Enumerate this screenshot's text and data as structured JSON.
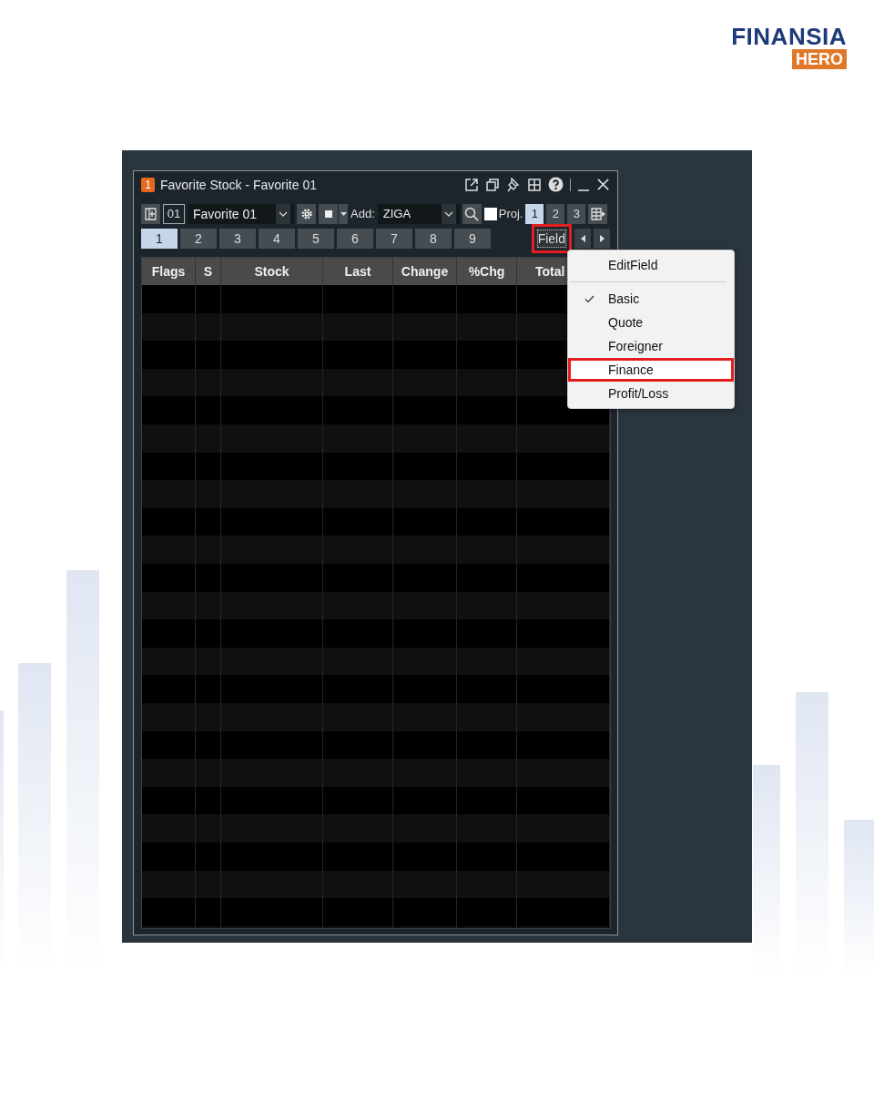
{
  "logo": {
    "name": "FINANSIA",
    "tag": "HERO"
  },
  "window": {
    "badge": "1",
    "title": "Favorite Stock - Favorite 01"
  },
  "toolbar": {
    "list_number": "01",
    "list_name": "Favorite 01",
    "add_label": "Add:",
    "symbol": "ZIGA",
    "proj_checked": false,
    "proj_label": "Proj.",
    "pages": [
      {
        "label": "1",
        "selected": true
      },
      {
        "label": "2",
        "selected": false
      },
      {
        "label": "3",
        "selected": false
      }
    ]
  },
  "tabs": [
    {
      "label": "1",
      "selected": true
    },
    {
      "label": "2",
      "selected": false
    },
    {
      "label": "3",
      "selected": false
    },
    {
      "label": "4",
      "selected": false
    },
    {
      "label": "5",
      "selected": false
    },
    {
      "label": "6",
      "selected": false
    },
    {
      "label": "7",
      "selected": false
    },
    {
      "label": "8",
      "selected": false
    },
    {
      "label": "9",
      "selected": false
    }
  ],
  "field_button": {
    "label": "Field",
    "highlighted": true
  },
  "table": {
    "columns": [
      "Flags",
      "S",
      "Stock",
      "Last",
      "Change",
      "%Chg",
      "Total"
    ]
  },
  "field_menu": {
    "items": [
      {
        "kind": "command",
        "label": "EditField",
        "checked": false,
        "highlighted": false
      },
      {
        "kind": "separator"
      },
      {
        "kind": "option",
        "label": "Basic",
        "checked": true,
        "highlighted": false
      },
      {
        "kind": "option",
        "label": "Quote",
        "checked": false,
        "highlighted": false
      },
      {
        "kind": "option",
        "label": "Foreigner",
        "checked": false,
        "highlighted": false
      },
      {
        "kind": "option",
        "label": "Finance",
        "checked": false,
        "highlighted": true
      },
      {
        "kind": "option",
        "label": "Profit/Loss",
        "checked": false,
        "highlighted": false
      }
    ]
  }
}
